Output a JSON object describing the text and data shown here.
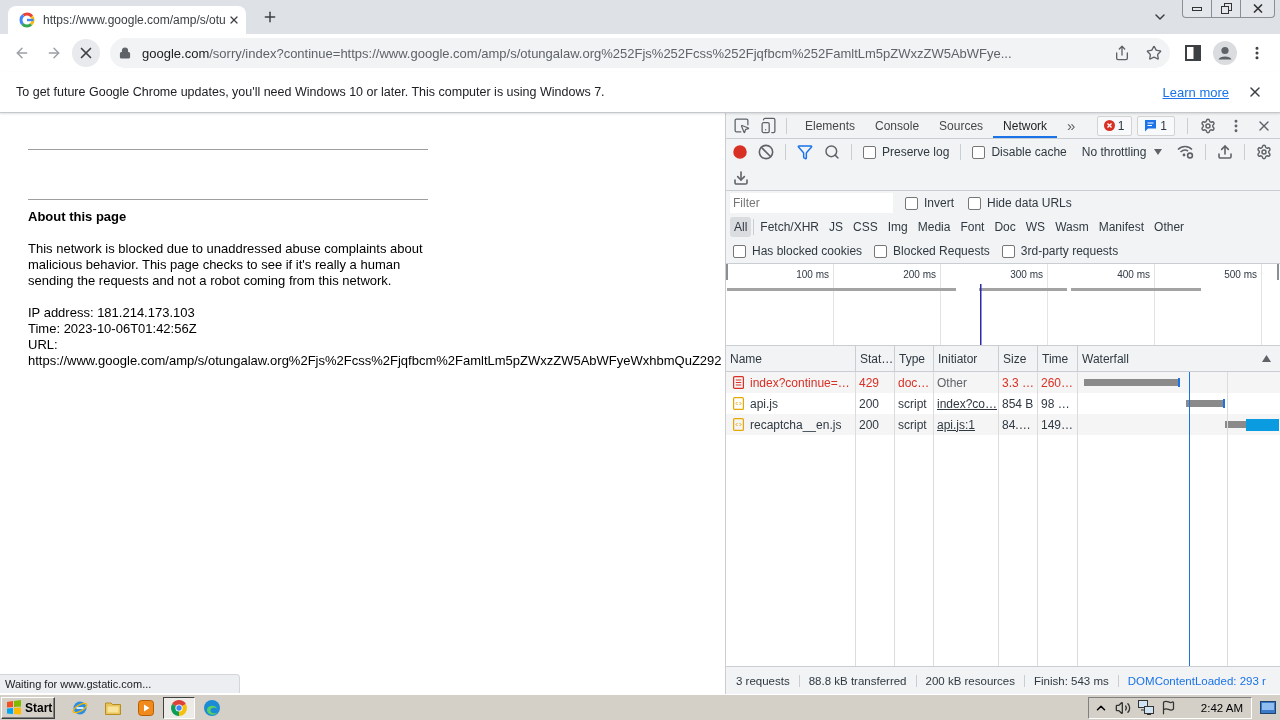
{
  "browser": {
    "tabs": [
      {
        "title": "https://www.google.com/amp/s/otu",
        "selected": true
      }
    ]
  },
  "toolbar": {
    "loading": true,
    "url_host": "google.com",
    "url_path": "/sorry/index?continue=https://www.google.com/amp/s/otungalaw.org%252Fjs%252Fcss%252Fjqfbcm%252FamltLm5pZWxzZW5AbWFye..."
  },
  "infobar": {
    "message": "To get future Google Chrome updates, you'll need Windows 10 or later. This computer is using Windows 7.",
    "link": "Learn more"
  },
  "page": {
    "heading": "About this page",
    "paragraph": "This network is blocked due to unaddressed abuse complaints about malicious behavior. This page checks to see if it's really a human sending the requests and not a robot coming from this network.",
    "details": [
      "IP address: 181.214.173.103",
      "Time: 2023-10-06T01:42:56Z",
      "URL:",
      "https://www.google.com/amp/s/otungalaw.org%2Fjs%2Fcss%2Fjqfbcm%2FamltLm5pZWxzZW5AbWFyeWxhbmQuZ292"
    ]
  },
  "status_bubble": "Waiting for www.gstatic.com...",
  "devtools": {
    "panels": [
      {
        "label": "Elements",
        "selected": false
      },
      {
        "label": "Console",
        "selected": false
      },
      {
        "label": "Sources",
        "selected": false
      },
      {
        "label": "Network",
        "selected": true
      }
    ],
    "more": "»",
    "error_count": "1",
    "message_count": "1",
    "toolbar": {
      "recording": true,
      "options": [
        {
          "label": "Preserve log",
          "checked": false
        },
        {
          "label": "Disable cache",
          "checked": false
        }
      ],
      "throttling": "No throttling"
    },
    "filter": {
      "placeholder": "Filter",
      "options": [
        {
          "label": "Invert",
          "checked": false
        },
        {
          "label": "Hide data URLs",
          "checked": false
        }
      ]
    },
    "type_filters": [
      {
        "label": "All",
        "selected": true
      },
      {
        "label": "Fetch/XHR",
        "selected": false
      },
      {
        "label": "JS",
        "selected": false
      },
      {
        "label": "CSS",
        "selected": false
      },
      {
        "label": "Img",
        "selected": false
      },
      {
        "label": "Media",
        "selected": false
      },
      {
        "label": "Font",
        "selected": false
      },
      {
        "label": "Doc",
        "selected": false
      },
      {
        "label": "WS",
        "selected": false
      },
      {
        "label": "Wasm",
        "selected": false
      },
      {
        "label": "Manifest",
        "selected": false
      },
      {
        "label": "Other",
        "selected": false
      }
    ],
    "request_filters": [
      {
        "label": "Has blocked cookies",
        "checked": false
      },
      {
        "label": "Blocked Requests",
        "checked": false
      },
      {
        "label": "3rd-party requests",
        "checked": false
      }
    ],
    "overview": {
      "ticks": [
        "100 ms",
        "200 ms",
        "300 ms",
        "400 ms",
        "500 ms"
      ]
    },
    "table": {
      "columns": [
        "Name",
        "Stat…",
        "Type",
        "Initiator",
        "Size",
        "Time",
        "Waterfall"
      ],
      "rows": [
        {
          "kind": "document",
          "error": true,
          "name": "index?continue=…",
          "status": "429",
          "type": "doc…",
          "initiator": "Other",
          "initiator_link": false,
          "size": "3.3 …",
          "time": "260…"
        },
        {
          "kind": "script",
          "error": false,
          "name": "api.js",
          "status": "200",
          "type": "script",
          "initiator": "index?co…",
          "initiator_link": true,
          "size": "854 B",
          "time": "98 …"
        },
        {
          "kind": "script",
          "error": false,
          "name": "recaptcha__en.js",
          "status": "200",
          "type": "script",
          "initiator": "api.js:1",
          "initiator_link": true,
          "size": "84.…",
          "time": "149…"
        }
      ]
    },
    "summary": [
      {
        "text": "3 requests",
        "kind": "plain"
      },
      {
        "text": "88.8 kB transferred",
        "kind": "plain"
      },
      {
        "text": "200 kB resources",
        "kind": "plain"
      },
      {
        "text": "Finish: 543 ms",
        "kind": "plain"
      },
      {
        "text": "DOMContentLoaded: 293 r",
        "kind": "dom_loaded"
      }
    ]
  },
  "taskbar": {
    "start": "Start",
    "apps": [
      {
        "kind": "globe",
        "selected": false
      },
      {
        "kind": "folder",
        "selected": false
      },
      {
        "kind": "player",
        "selected": false
      },
      {
        "kind": "chrome",
        "selected": true
      },
      {
        "kind": "edge",
        "selected": false
      }
    ],
    "clock": "2:42 AM"
  }
}
